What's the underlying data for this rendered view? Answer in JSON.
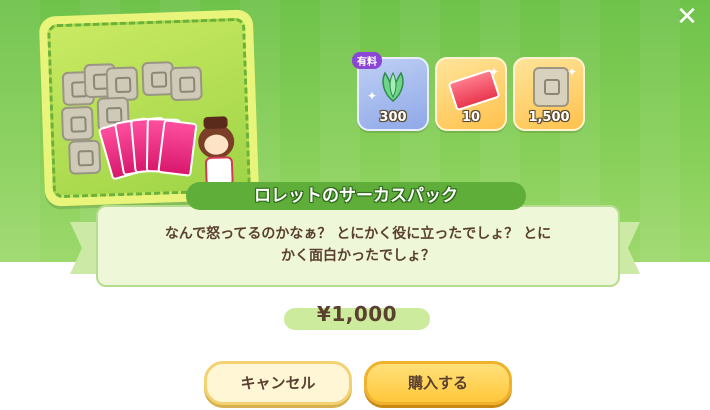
{
  "dialog": {
    "close_label": "✕",
    "product": {
      "title": "ロレットのサーカスパック",
      "description_line1": "なんで怒ってるのかなぁ？ とにかく役に立ったでしょ？ とに",
      "description_line2": "かく面白かったでしょ？",
      "price": "¥1,000"
    },
    "rewards": [
      {
        "name": "crystal",
        "badge": "有料",
        "count": "300"
      },
      {
        "name": "ticket",
        "count": "10"
      },
      {
        "name": "soulstone",
        "count": "1,500"
      }
    ],
    "buttons": {
      "cancel": "キャンセル",
      "buy": "購入する"
    }
  },
  "colors": {
    "background_green": "#86cf58",
    "title_ribbon": "#5fae3a",
    "buy_button": "#ffc83b",
    "cancel_button": "#fff6d6",
    "paid_badge": "#8b46d6"
  }
}
